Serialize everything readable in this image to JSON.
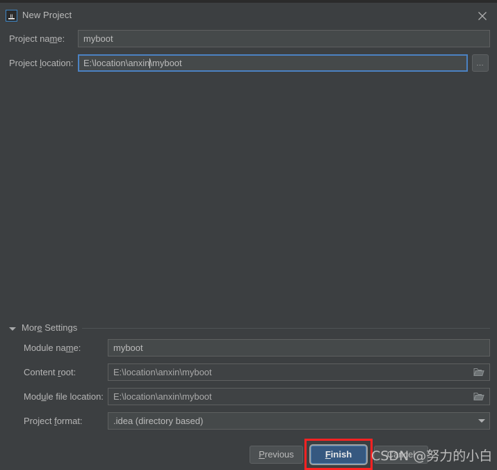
{
  "window": {
    "title": "New Project",
    "app_icon": "intellij-idea-icon",
    "close_icon": "close-icon",
    "colors": {
      "background": "#3c3f41",
      "titlebar_strip": "#2b2b2b",
      "field_background": "#45494a",
      "field_border": "#5e6060",
      "focus_border": "#4b82c3",
      "default_button": "#365880",
      "text": "#b6b6b6",
      "highlight_box": "#ff2222"
    }
  },
  "form": {
    "project_name": {
      "label": "Project name:",
      "mnemonic": "m",
      "value": "myboot",
      "placeholder": ""
    },
    "project_location": {
      "label": "Project location:",
      "mnemonic": "l",
      "value_before_caret": "E:\\location\\anxin",
      "value_after_caret": "\\myboot",
      "value": "E:\\location\\anxin\\myboot",
      "placeholder": "",
      "focused": true,
      "browse_button_label": "...",
      "browse_icon": "ellipsis-icon"
    }
  },
  "more_settings": {
    "label": "More Settings",
    "mnemonic": "e",
    "expanded": true,
    "toggle_icon": "triangle-down-icon",
    "rows": [
      {
        "label": "Module name:",
        "mnemonic": "m",
        "value": "myboot",
        "type": "text",
        "readonly": false,
        "icon": null
      },
      {
        "label": "Content root:",
        "mnemonic": "r",
        "value": "E:\\location\\anxin\\myboot",
        "type": "text",
        "readonly": true,
        "icon": "folder-icon"
      },
      {
        "label": "Module file location:",
        "mnemonic": "u",
        "value": "E:\\location\\anxin\\myboot",
        "type": "text",
        "readonly": true,
        "icon": "folder-icon"
      },
      {
        "label": "Project format:",
        "mnemonic": "f",
        "value": ".idea (directory based)",
        "type": "combobox",
        "readonly": false,
        "icon": "chevron-down-icon"
      }
    ]
  },
  "footer": {
    "previous": {
      "label": "Previous",
      "mnemonic": "P"
    },
    "finish": {
      "label": "Finish",
      "mnemonic": "F",
      "is_default": true,
      "highlighted": true
    },
    "cancel": {
      "label": "Cancel",
      "mnemonic": ""
    }
  },
  "watermark": {
    "text": "CSDN @努力的小白"
  }
}
